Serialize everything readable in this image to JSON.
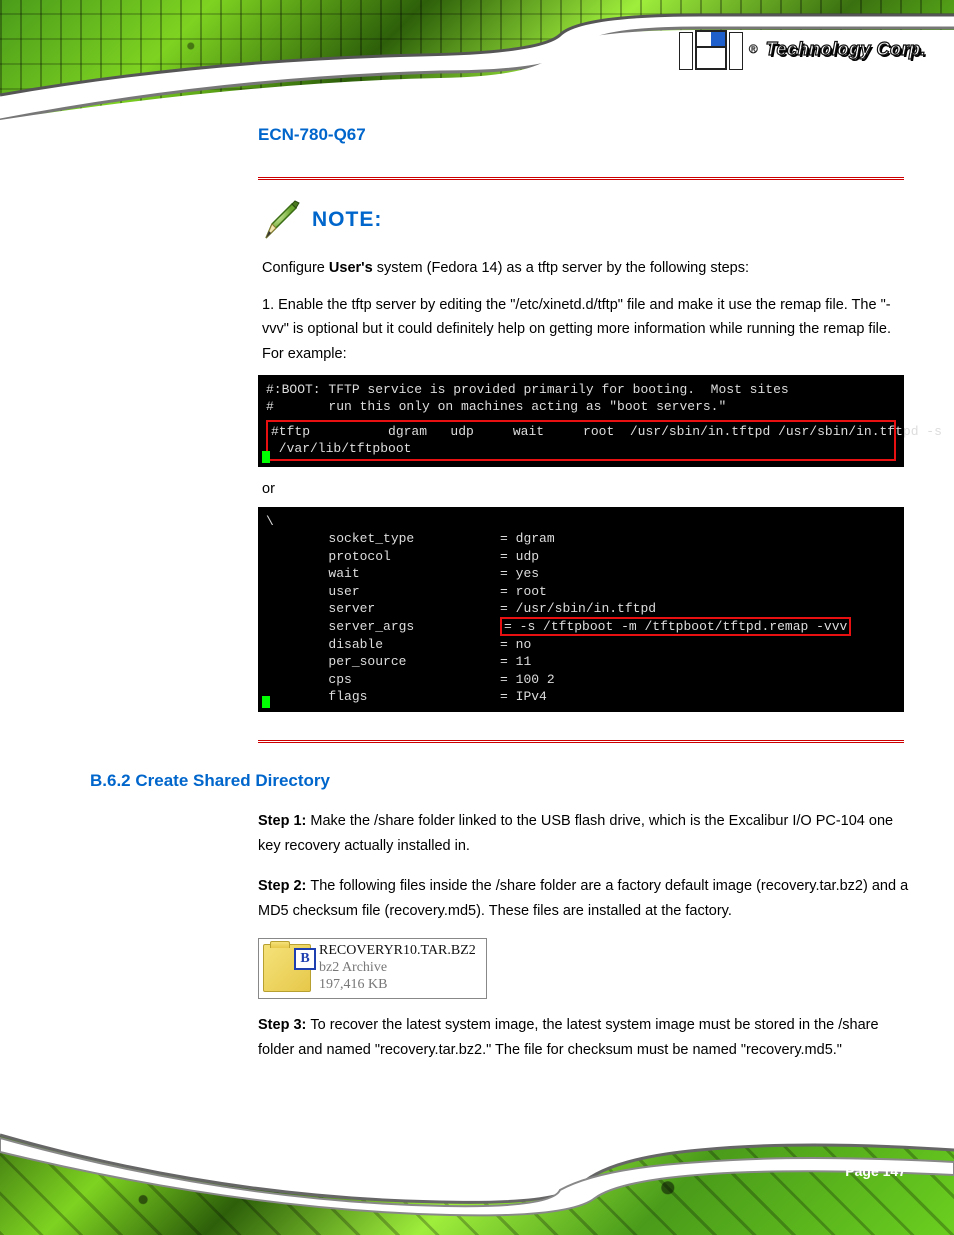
{
  "brand": {
    "reg": "®",
    "name": "Technology Corp."
  },
  "header": {
    "model": "ECN-780-Q67"
  },
  "note": {
    "title": "NOTE:",
    "body_prefix": "Configure ",
    "body_em": "User's",
    "body_rest": " system (Fedora 14) as a tftp server by the following steps:",
    "step1": "1. Enable the tftp server by editing the \"/etc/xinetd.d/tftp\" file and make it use the remap file. The \"-vvv\" is optional but it could definitely help on getting more information while running the remap file. For example:",
    "term1_comment": "#:BOOT: TFTP service is provided primarily for booting.  Most sites\n#       run this only on machines acting as \"boot servers.\"",
    "term1_highlight": "#tftp          dgram   udp     wait     root  /usr/sbin/in.tftpd /usr/sbin/in.tftpd -s\n /var/lib/tftpboot",
    "term1_label": "#tftp",
    "or": "or",
    "term2_lines": [
      "        socket_type           = dgram",
      "        protocol              = udp",
      "        wait                  = yes",
      "        user                  = root",
      "        server                = /usr/sbin/in.tftpd"
    ],
    "term2_hl_key": "        server_args           ",
    "term2_hl_val": "= -s /tftpboot -m /tftpboot/tftpd.remap -vvv",
    "term2_lines_after": [
      "        disable               = no",
      "        per_source            = 11",
      "        cps                   = 100 2",
      "        flags                 = IPv4"
    ]
  },
  "section": {
    "heading": "B.6.2  Create Shared Directory",
    "step1_label": "Step 1:",
    "step1_text": "Make the /share folder linked to the USB flash drive, which is the Excalibur I/O PC-104 one key recovery actually installed in.",
    "step2_label": "Step 2:",
    "step2_text": "The following files inside the /share folder are a factory default image (recovery.tar.bz2) and a MD5 checksum file (recovery.md5). These files are installed at the factory.",
    "step3_label": "Step 3:",
    "step3_text": "To recover the latest system image, the latest system image must be stored in the /share folder and named \"recovery.tar.bz2.\" The file for checksum must be named \"recovery.md5.\""
  },
  "file": {
    "name": "RECOVERYR10.TAR.BZ2",
    "type": "bz2 Archive",
    "size": "197,416 KB"
  },
  "footer": {
    "page": "Page 147"
  }
}
